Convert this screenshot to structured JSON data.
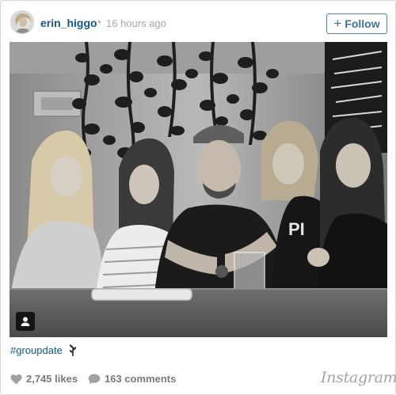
{
  "post": {
    "username": "erin_higgo",
    "separator": "•",
    "timestamp": "16 hours ago",
    "follow_label": "Follow",
    "follow_plus": "+"
  },
  "caption": {
    "hashtag": "#groupdate"
  },
  "footer": {
    "likes": "2,745 likes",
    "comments": "163 comments",
    "brand": "Instagram"
  },
  "icons": {
    "avatar": "user-avatar",
    "tag": "user-tag-icon",
    "caption_emoji": "plant-emoji",
    "likes": "heart-icon",
    "comments": "comment-bubble-icon"
  },
  "colors": {
    "link": "#125688",
    "follow_border": "#4c83b4",
    "follow_text": "#3f729b",
    "muted": "#a5a7aa",
    "icon_gray": "#a0a0a0"
  }
}
